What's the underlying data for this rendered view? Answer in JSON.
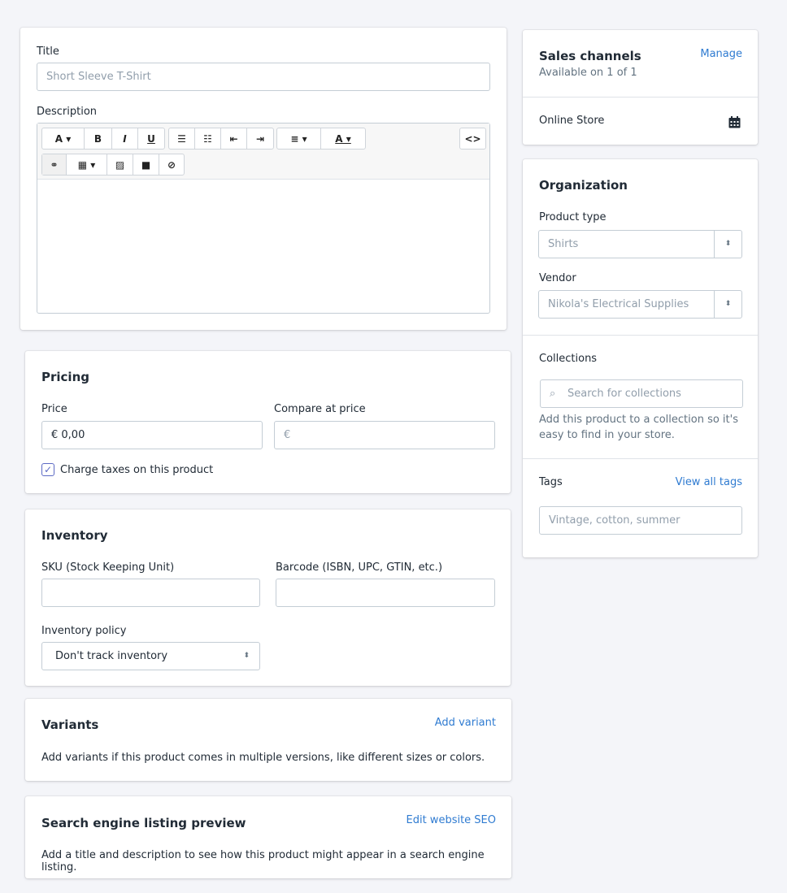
{
  "product": {
    "title_label": "Title",
    "title_placeholder": "Short Sleeve T-Shirt",
    "description_label": "Description"
  },
  "editor": {
    "toolbar": [
      "A ▾",
      "B",
      "I",
      "U",
      "☰",
      "☷",
      "⇤",
      "⇥",
      "≡ ▾",
      "A ▾",
      "<>",
      "⚭",
      "▦ ▾",
      "▨",
      "■",
      "⊘"
    ]
  },
  "pricing": {
    "heading": "Pricing",
    "price_label": "Price",
    "price_value": "€ 0,00",
    "compare_label": "Compare at price",
    "compare_placeholder": "€",
    "charge_taxes_label": "Charge taxes on this product",
    "charge_taxes_checked": true
  },
  "inventory": {
    "heading": "Inventory",
    "sku_label": "SKU (Stock Keeping Unit)",
    "barcode_label": "Barcode (ISBN, UPC, GTIN, etc.)",
    "policy_label": "Inventory policy",
    "policy_value": "Don't track inventory"
  },
  "variants": {
    "heading": "Variants",
    "action": "Add variant",
    "text": "Add variants if this product comes in multiple versions, like different sizes or colors."
  },
  "seo": {
    "heading": "Search engine listing preview",
    "action": "Edit website SEO",
    "text": "Add a title and description to see how this product might appear in a search engine listing."
  },
  "sales_channels": {
    "heading": "Sales channels",
    "subtitle": "Available on 1 of 1",
    "action": "Manage",
    "channel": "Online Store",
    "channel_icon": "calendar-icon"
  },
  "organization": {
    "heading": "Organization",
    "product_type_label": "Product type",
    "product_type_value": "Shirts",
    "vendor_label": "Vendor",
    "vendor_value": "Nikola's Electrical Supplies",
    "collections_label": "Collections",
    "collections_placeholder": "Search for collections",
    "collections_help": "Add this product to a collection so it's easy to find in your store.",
    "tags_label": "Tags",
    "tags_action": "View all tags",
    "tags_placeholder": "Vintage, cotton, summer"
  },
  "colors": {
    "link": "#2f7bd1",
    "background": "#f4f5f9",
    "border": "#c4cdd5"
  }
}
